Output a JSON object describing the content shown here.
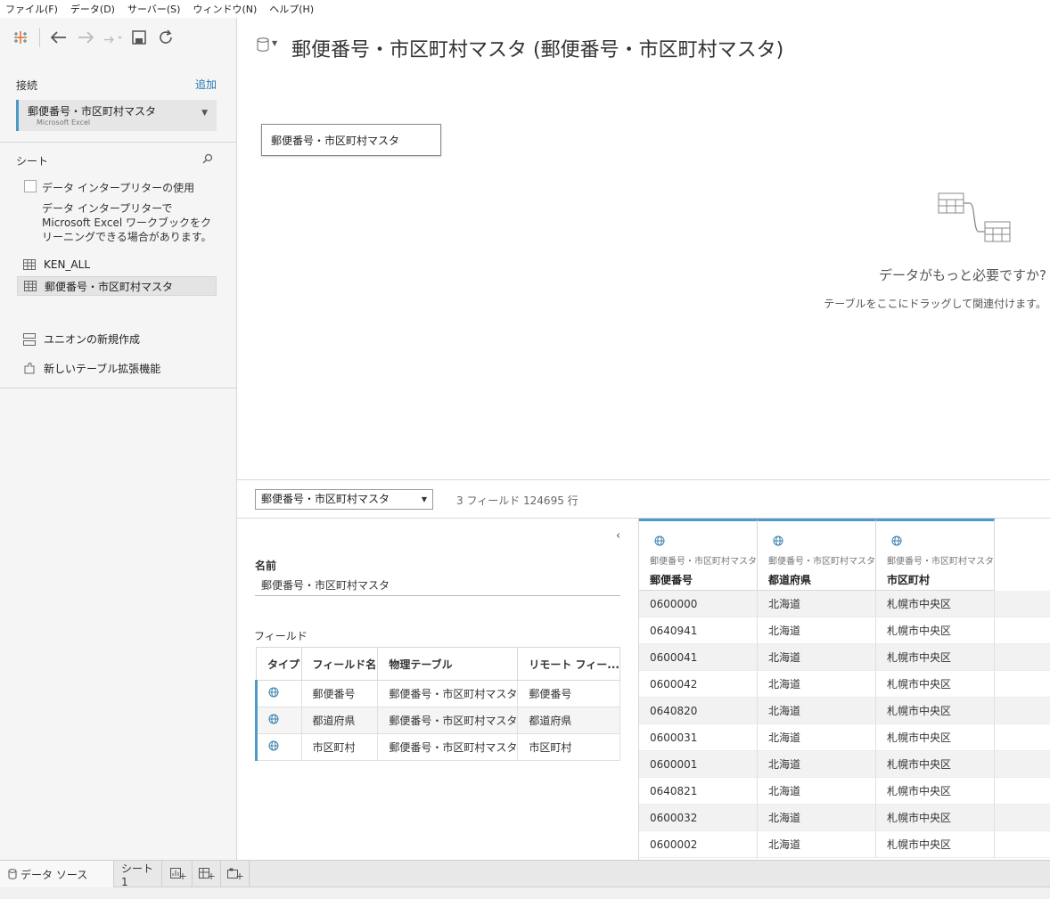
{
  "menu": [
    "ファイル(F)",
    "データ(D)",
    "サーバー(S)",
    "ウィンドウ(N)",
    "ヘルプ(H)"
  ],
  "left": {
    "connections_title": "接続",
    "add_label": "追加",
    "connection": {
      "name": "郵便番号・市区町村マスタ",
      "type": "Microsoft Excel"
    },
    "sheets_title": "シート",
    "interpreter_label": "データ インタープリターの使用",
    "interpreter_desc": "データ インタープリターで Microsoft Excel ワークブックをクリーニングできる場合があります。",
    "sheets": [
      "KEN_ALL",
      "郵便番号・市区町村マスタ"
    ],
    "actions": [
      "ユニオンの新規作成",
      "新しいテーブル拡張機能"
    ]
  },
  "canvas": {
    "title": "郵便番号・市区町村マスタ (郵便番号・市区町村マスタ)",
    "table_card": "郵便番号・市区町村マスタ",
    "hint_title": "データがもっと必要ですか?",
    "hint_sub": "テーブルをここにドラッグして関連付けます。"
  },
  "bottom": {
    "table_select": "郵便番号・市区町村マスタ",
    "field_count": "3 フィールド 124695 行"
  },
  "meta": {
    "name_label": "名前",
    "name_value": "郵便番号・市区町村マスタ",
    "fields_label": "フィールド",
    "columns": [
      "タイプ",
      "フィールド名",
      "物理テーブル",
      "リモート フィー..."
    ],
    "rows": [
      {
        "name": "郵便番号",
        "table": "郵便番号・市区町村マスタ",
        "remote": "郵便番号"
      },
      {
        "name": "都道府県",
        "table": "郵便番号・市区町村マスタ",
        "remote": "都道府県"
      },
      {
        "name": "市区町村",
        "table": "郵便番号・市区町村マスタ",
        "remote": "市区町村"
      }
    ]
  },
  "grid": {
    "columns": [
      {
        "source": "郵便番号・市区町村マスタ",
        "name": "郵便番号"
      },
      {
        "source": "郵便番号・市区町村マスタ",
        "name": "都道府県"
      },
      {
        "source": "郵便番号・市区町村マスタ",
        "name": "市区町村"
      }
    ],
    "rows": [
      [
        "0600000",
        "北海道",
        "札幌市中央区"
      ],
      [
        "0640941",
        "北海道",
        "札幌市中央区"
      ],
      [
        "0600041",
        "北海道",
        "札幌市中央区"
      ],
      [
        "0600042",
        "北海道",
        "札幌市中央区"
      ],
      [
        "0640820",
        "北海道",
        "札幌市中央区"
      ],
      [
        "0600031",
        "北海道",
        "札幌市中央区"
      ],
      [
        "0600001",
        "北海道",
        "札幌市中央区"
      ],
      [
        "0640821",
        "北海道",
        "札幌市中央区"
      ],
      [
        "0600032",
        "北海道",
        "札幌市中央区"
      ],
      [
        "0600002",
        "北海道",
        "札幌市中央区"
      ]
    ]
  },
  "tabs": {
    "datasource": "データ ソース",
    "sheet1": "シート 1"
  },
  "colors": {
    "accent": "#4e9ac7",
    "link": "#1f77b4"
  }
}
